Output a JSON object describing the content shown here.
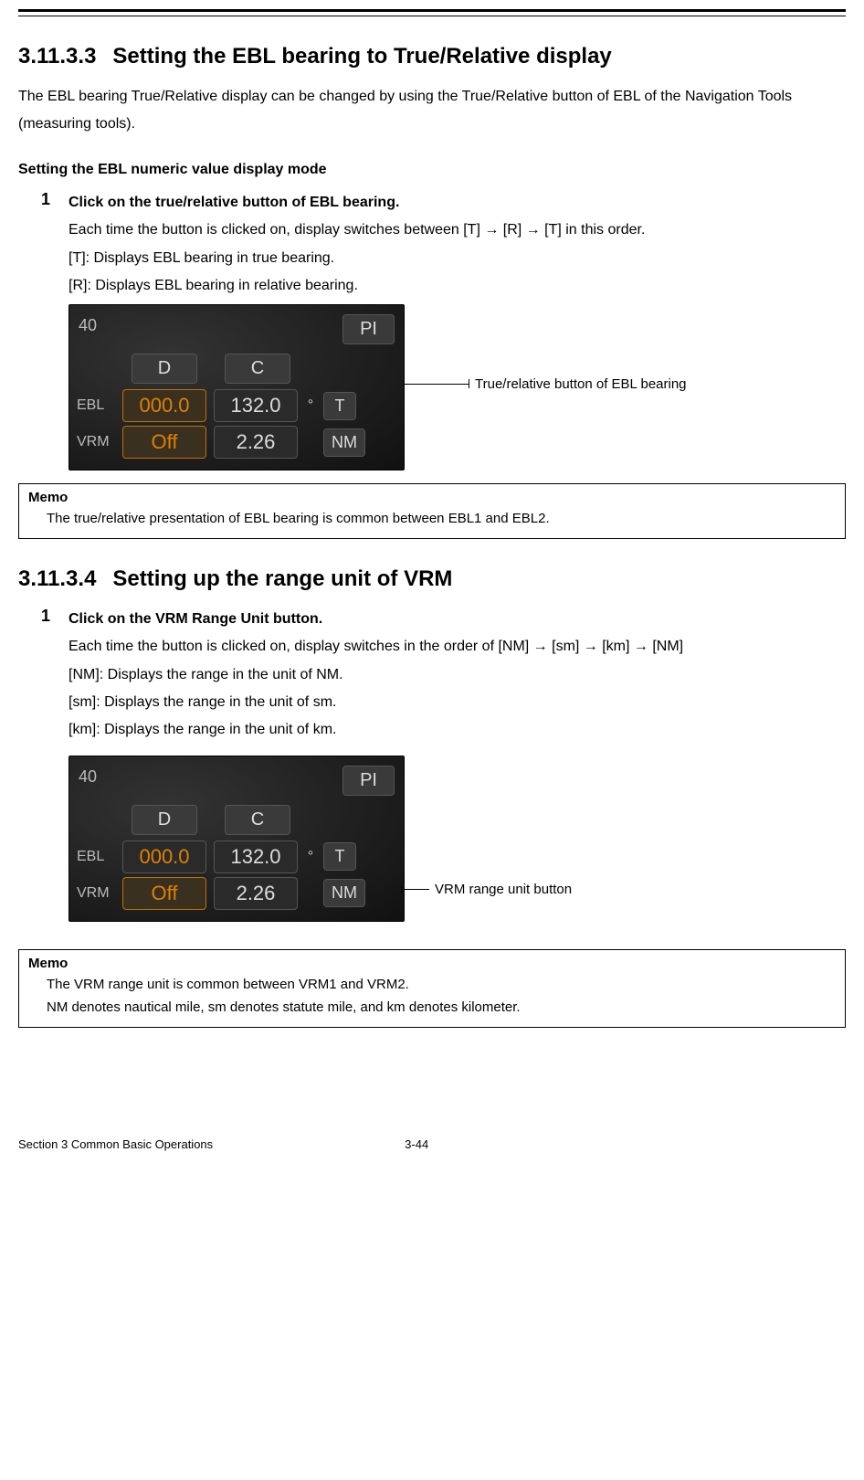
{
  "section_a": {
    "number": "3.11.3.3",
    "title": "Setting the EBL bearing to True/Relative display",
    "intro": "The EBL bearing True/Relative display can be changed by using the True/Relative button of EBL of the Navigation Tools (measuring tools).",
    "subhead": "Setting the EBL numeric value display mode",
    "step_num": "1",
    "step_title": "Click on the true/relative button of EBL bearing.",
    "line1": "Each time the button is clicked on, display switches between [T] → [R] → [T] in this order.",
    "line2": "[T]: Displays EBL bearing in true bearing.",
    "line3": "[R]: Displays EBL bearing in relative bearing.",
    "callout": "True/relative button of EBL bearing",
    "memo_title": "Memo",
    "memo_line": "The true/relative presentation of EBL bearing is common between EBL1 and EBL2."
  },
  "section_b": {
    "number": "3.11.3.4",
    "title": "Setting up the range unit of VRM",
    "step_num": "1",
    "step_title": "Click on the VRM Range Unit button.",
    "line1": "Each time the button is clicked on, display switches in the order of [NM] → [sm] → [km] → [NM]",
    "line2": "[NM]: Displays the range in the unit of NM.",
    "line3": "[sm]: Displays the range in the unit of sm.",
    "line4": "[km]: Displays the range in the unit of km.",
    "callout": "VRM range unit button",
    "memo_title": "Memo",
    "memo_line1": "The VRM range unit is common between VRM1 and VRM2.",
    "memo_line2": "NM denotes nautical mile, sm denotes statute mile, and km denotes kilometer."
  },
  "panel": {
    "topleft": "40",
    "pi": "PI",
    "d": "D",
    "c": "C",
    "ebl_label": "EBL",
    "ebl_val1": "000.0",
    "ebl_val2": "132.0",
    "deg": "°",
    "t": "T",
    "vrm_label": "VRM",
    "vrm_val1": "Off",
    "vrm_val2": "2.26",
    "nm": "NM"
  },
  "footer": {
    "left": "Section 3    Common Basic Operations",
    "page": "3-44"
  }
}
